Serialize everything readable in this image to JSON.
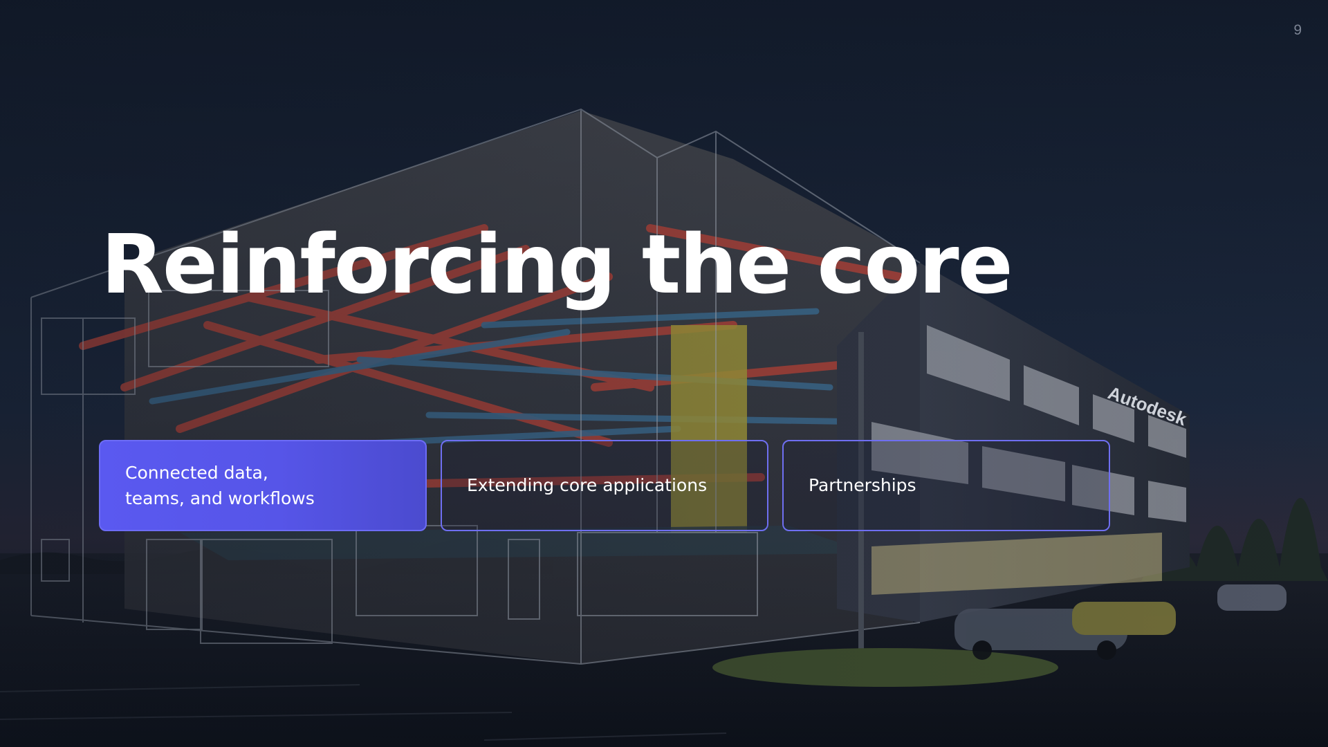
{
  "slide": {
    "page_number": "9",
    "title": "Reinforcing the core",
    "pillars": [
      {
        "label": "Connected data,\nteams, and workflows",
        "active": true
      },
      {
        "label": "Extending core applications",
        "active": false
      },
      {
        "label": "Partnerships",
        "active": false
      }
    ],
    "building_sign": "Autodesk"
  },
  "colors": {
    "accent": "#5a59f0",
    "accent_border": "#6f6ff2",
    "background": "#111b2c",
    "title_text": "#ffffff",
    "page_number_text": "#7c8494"
  }
}
